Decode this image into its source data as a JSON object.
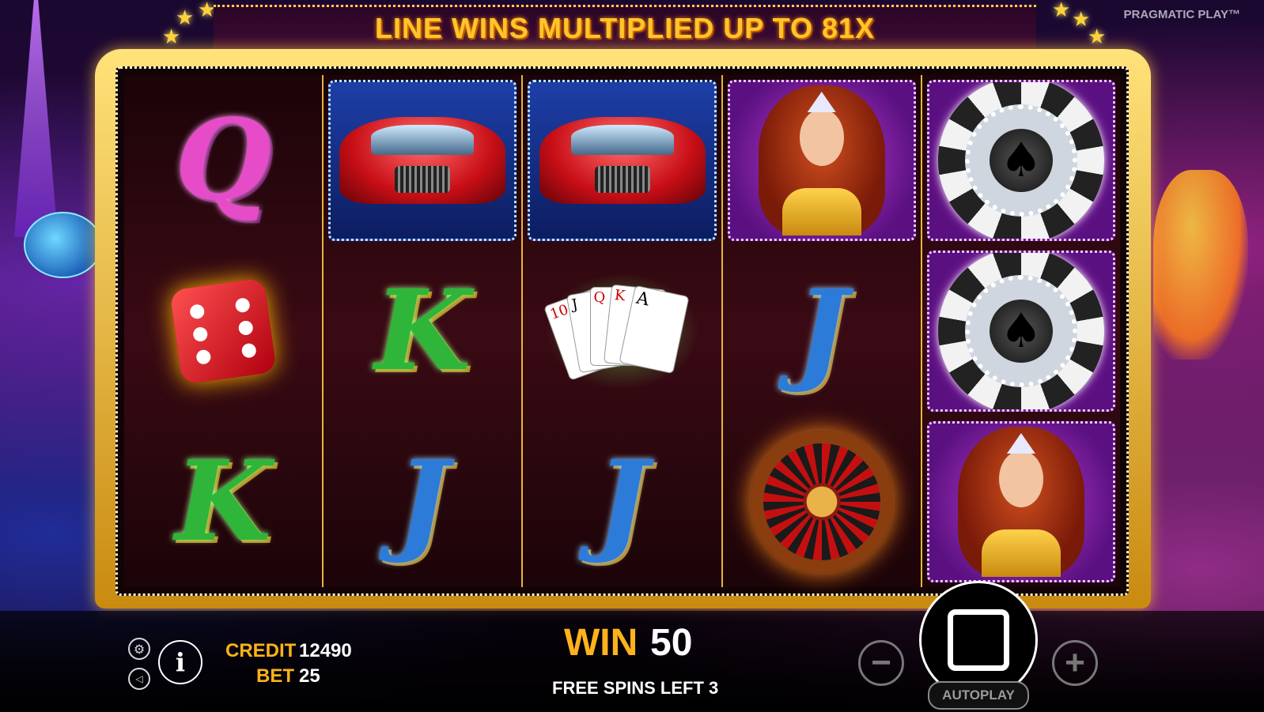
{
  "banner": {
    "text": "LINE WINS MULTIPLIED UP TO 81X"
  },
  "provider": {
    "name": "PRAGMATIC PLAY™"
  },
  "reels": [
    [
      "letter-Q",
      "dice",
      "letter-K"
    ],
    [
      "car",
      "letter-K",
      "letter-J"
    ],
    [
      "car",
      "cards",
      "letter-J"
    ],
    [
      "lady",
      "letter-J",
      "roulette"
    ],
    [
      "chip",
      "chip",
      "lady"
    ]
  ],
  "symbols": {
    "q": "Q",
    "k": "K",
    "j": "J"
  },
  "cards": [
    "10",
    "J",
    "Q",
    "K",
    "A"
  ],
  "hud": {
    "credit_label": "CREDIT",
    "credit_value": "12490",
    "bet_label": "BET",
    "bet_value": "25",
    "win_label": "WIN",
    "win_value": "50",
    "free_spins_text": "FREE SPINS LEFT 3",
    "autoplay_label": "AUTOPLAY",
    "minus": "−",
    "plus": "+",
    "info": "i"
  },
  "colors": {
    "gold": "#ffb21a",
    "frame": "#e8b53a"
  }
}
